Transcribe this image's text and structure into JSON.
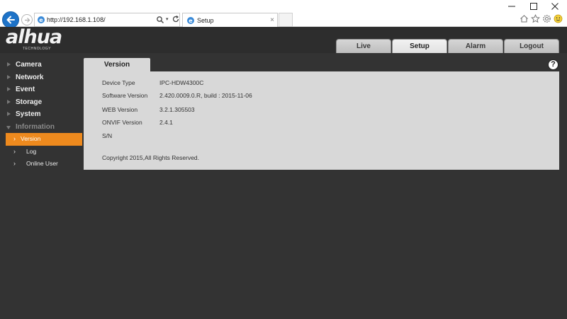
{
  "browser": {
    "address": "http://192.168.1.108/",
    "tab_title": "Setup",
    "tab_close": "×"
  },
  "logo": {
    "word": "alhua",
    "sub": "TECHNOLOGY"
  },
  "nav": {
    "tabs": [
      {
        "label": "Live"
      },
      {
        "label": "Setup"
      },
      {
        "label": "Alarm"
      },
      {
        "label": "Logout"
      }
    ],
    "active": "Setup"
  },
  "sidebar": {
    "categories": [
      {
        "label": "Camera"
      },
      {
        "label": "Network"
      },
      {
        "label": "Event"
      },
      {
        "label": "Storage"
      },
      {
        "label": "System"
      },
      {
        "label": "Information"
      }
    ],
    "sub_items": [
      {
        "label": "Version"
      },
      {
        "label": "Log"
      },
      {
        "label": "Online User"
      }
    ],
    "active_sub": "Version"
  },
  "panel": {
    "tab_label": "Version",
    "help": "?",
    "rows": [
      {
        "label": "Device Type",
        "value": "IPC-HDW4300C"
      },
      {
        "label": "Software Version",
        "value": "2.420.0009.0.R, build : 2015-11-06"
      },
      {
        "label": "WEB Version",
        "value": "3.2.1.305503"
      },
      {
        "label": "ONVIF Version",
        "value": "2.4.1"
      },
      {
        "label": "S/N",
        "value": ""
      }
    ],
    "copyright": "Copyright 2015,All Rights Reserved."
  },
  "colors": {
    "accent_orange": "#ee8a1e",
    "background": "#333333",
    "panel": "#d8d8d8",
    "browser_back": "#1e73c8"
  },
  "icons": [
    "back-arrow-icon",
    "forward-arrow-icon",
    "ie-page-icon",
    "search-icon",
    "refresh-icon",
    "home-icon",
    "star-icon",
    "gear-icon",
    "smiley-icon",
    "help-icon"
  ]
}
